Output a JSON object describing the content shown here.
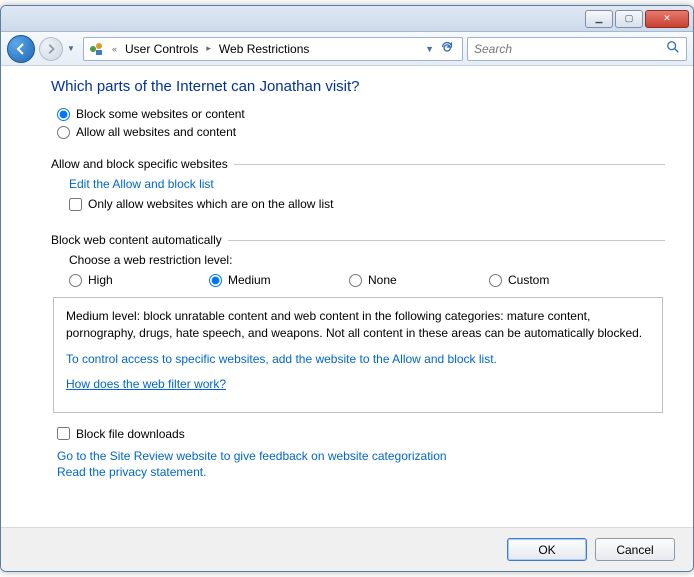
{
  "titlebar": {
    "minimize": "▁",
    "maximize": "▢",
    "close": "✕"
  },
  "nav": {
    "collapse": "«",
    "crumb1": "User Controls",
    "crumb2": "Web Restrictions",
    "search_placeholder": "Search"
  },
  "page": {
    "title": "Which parts of the Internet can Jonathan visit?",
    "opt_block": "Block some websites or content",
    "opt_allow": "Allow all websites and content"
  },
  "section_specific": {
    "legend": "Allow and block specific websites",
    "edit_link": "Edit the Allow and block list",
    "only_allow": "Only allow websites which are on the allow list"
  },
  "section_auto": {
    "legend": "Block web content automatically",
    "choose": "Choose a web restriction level:",
    "high": "High",
    "medium": "Medium",
    "none": "None",
    "custom": "Custom",
    "desc": "Medium level:  block unratable content and web content in the following categories:  mature content, pornography, drugs, hate speech, and weapons.  Not all content in these areas can be automatically blocked.",
    "control_link": "To control access to specific websites, add the website to the Allow and block list.",
    "how_link": "How does the web filter work?"
  },
  "downloads": {
    "block": "Block file downloads"
  },
  "footer_links": {
    "feedback": "Go to the Site Review website to give feedback on website categorization",
    "privacy": "Read the privacy statement."
  },
  "buttons": {
    "ok": "OK",
    "cancel": "Cancel"
  }
}
